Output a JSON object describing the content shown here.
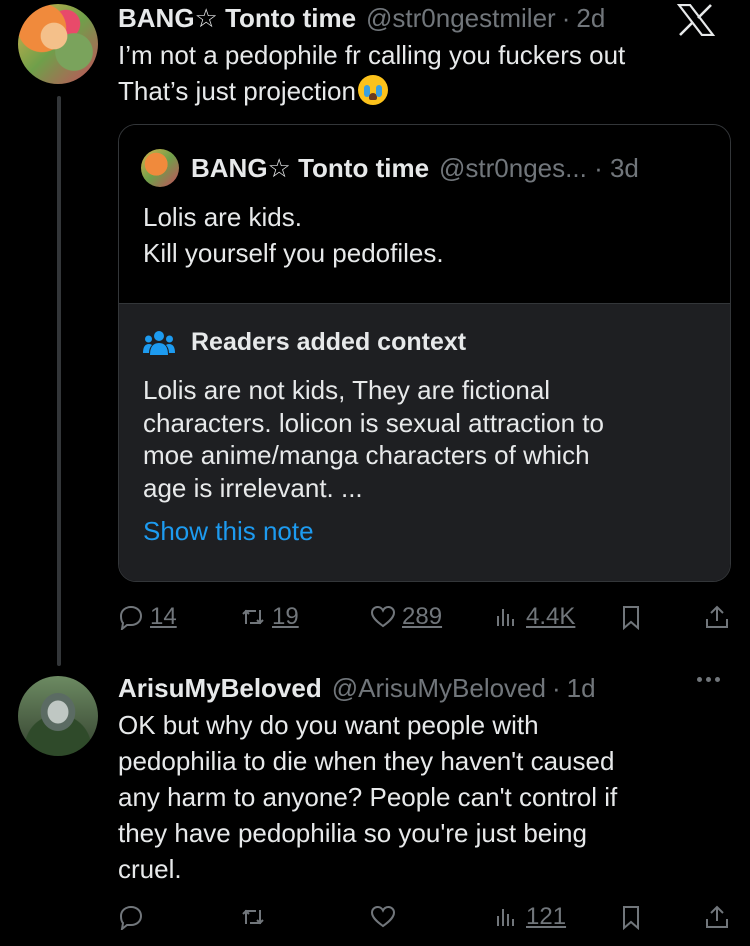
{
  "tweet1": {
    "author_name": "BANG☆ Tonto time",
    "handle": "@str0ngestmiler",
    "separator": "·",
    "time": "2d",
    "line1": "I’m not a pedophile fr calling you fuckers out",
    "line2": "That’s just projection",
    "emoji": "loudly-crying-face",
    "quote": {
      "author_name": "BANG☆ Tonto time",
      "handle": "@str0nges...",
      "separator": "·",
      "time": "3d",
      "line1": "Lolis are kids.",
      "line2": "Kill yourself you pedofiles.",
      "note": {
        "title": "Readers added context",
        "lines": [
          "Lolis are not kids, They are fictional",
          "characters. lolicon is sexual attraction to",
          "moe anime/manga characters of which",
          "age is irrelevant. ..."
        ],
        "link": "Show this note"
      }
    },
    "actions": {
      "replies": "14",
      "retweets": "19",
      "likes": "289",
      "views": "4.4K"
    }
  },
  "tweet2": {
    "author_name": "ArisuMyBeloved",
    "handle": "@ArisuMyBeloved",
    "separator": "·",
    "time": "1d",
    "lines": [
      "OK but why do you want people with",
      "pedophilia to die when they haven't caused",
      "any harm to anyone? People can't control if",
      "they have pedophilia so you're just being",
      "cruel."
    ],
    "actions": {
      "replies": "",
      "retweets": "",
      "likes": "",
      "views": "121"
    }
  },
  "colors": {
    "background": "#000000",
    "text": "#e7e9ea",
    "secondary": "#71767b",
    "link": "#1d9bf0",
    "note_bg": "#1e1f22",
    "border": "#333639"
  },
  "icons": [
    "x-logo-icon",
    "community-notes-icon",
    "reply-icon",
    "retweet-icon",
    "like-icon",
    "views-icon",
    "bookmark-icon",
    "share-icon",
    "more-icon"
  ]
}
